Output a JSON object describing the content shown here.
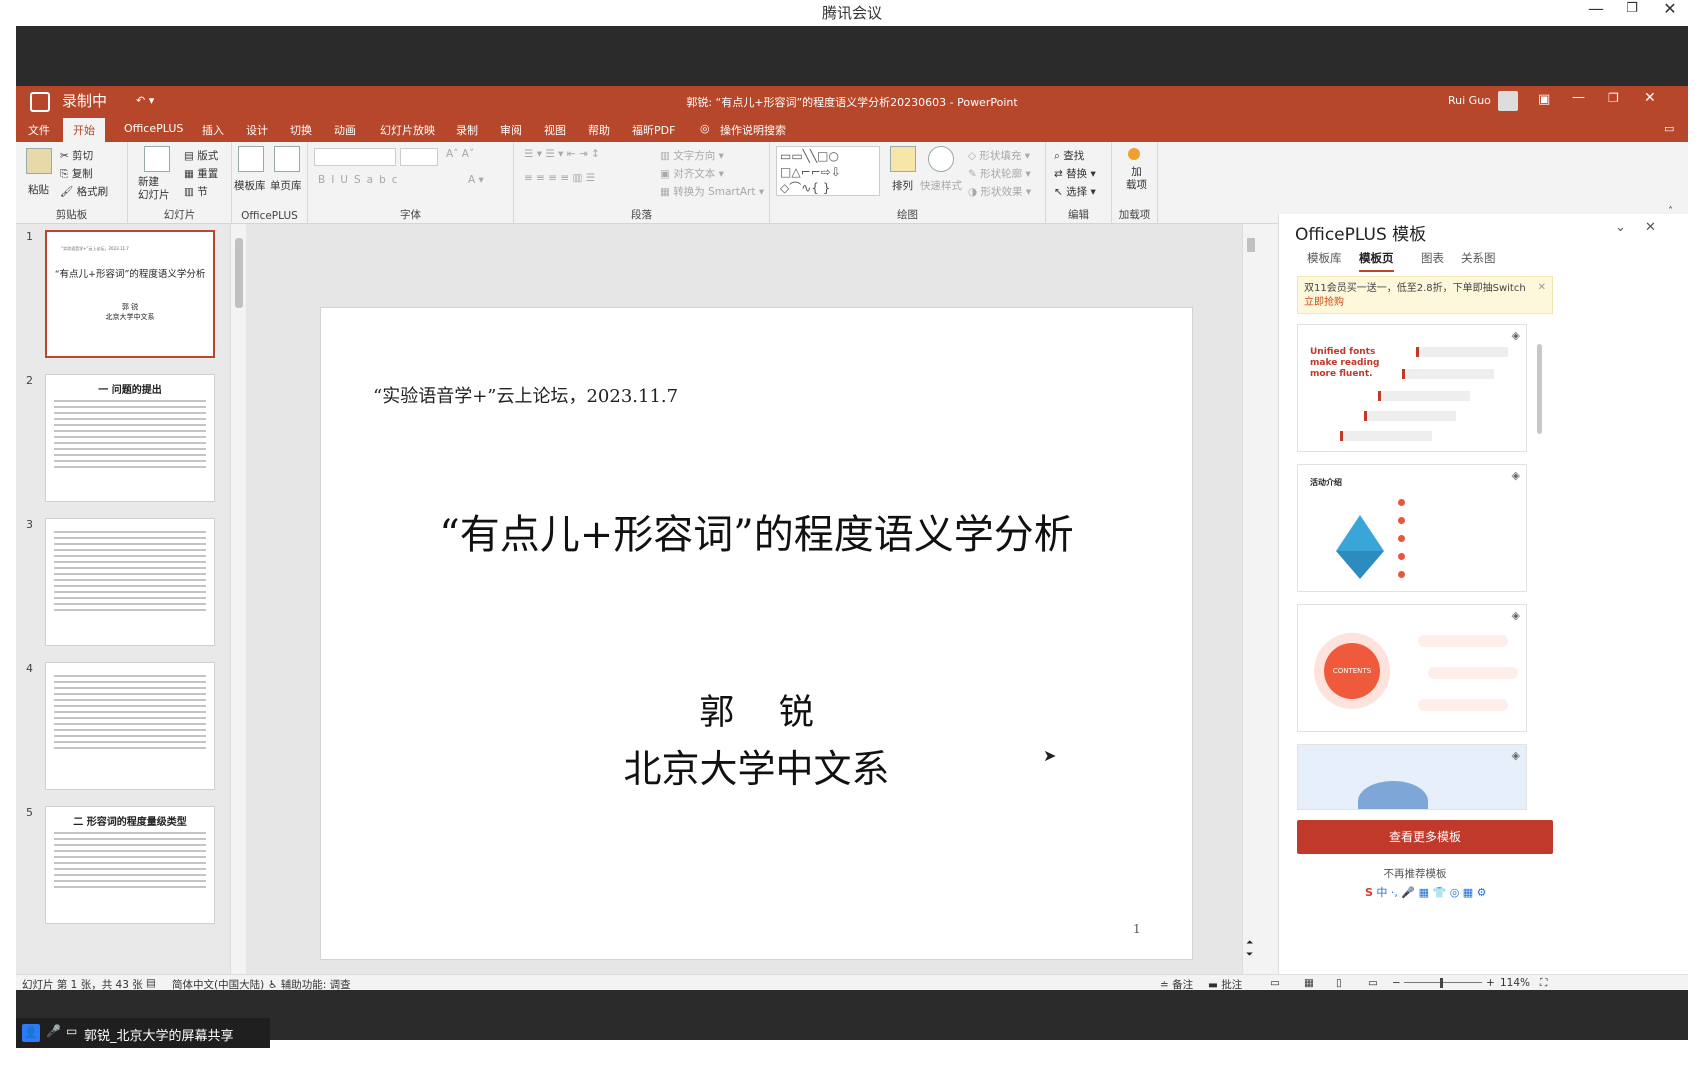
{
  "meeting_window": {
    "title": "腾讯会议",
    "share_label": "郭锐_北京大学的屏幕共享"
  },
  "recording": {
    "label": "录制中"
  },
  "ppt": {
    "doc_title": "郭锐: “有点儿+形容词”的程度语义学分析20230603  -  PowerPoint",
    "user": "Rui Guo",
    "tabs": [
      "文件",
      "开始",
      "OfficePLUS",
      "插入",
      "设计",
      "切换",
      "动画",
      "幻灯片放映",
      "录制",
      "审阅",
      "视图",
      "帮助",
      "福昕PDF",
      "操作说明搜索"
    ],
    "ribbon": {
      "clipboard": {
        "paste": "粘贴",
        "cut": "剪切",
        "copy": "复制",
        "format_painter": "格式刷",
        "label": "剪贴板"
      },
      "slides": {
        "new_slide": "新建\n幻灯片",
        "layout": "版式",
        "reset": "重置",
        "section": "节",
        "label": "幻灯片"
      },
      "officeplus": {
        "template_lib": "模板库",
        "single_page_lib": "单页库",
        "label": "OfficePLUS"
      },
      "font": {
        "label": "字体"
      },
      "paragraph": {
        "text_direction": "文字方向",
        "align_text": "对齐文本",
        "convert_smartart": "转换为 SmartArt",
        "label": "段落"
      },
      "drawing": {
        "arrange": "排列",
        "quick_styles": "快速样式",
        "shape_fill": "形状填充",
        "shape_outline": "形状轮廓",
        "shape_effects": "形状效果",
        "label": "绘图"
      },
      "editing": {
        "find": "查找",
        "replace": "替换",
        "select": "选择",
        "label": "编辑"
      },
      "addins": {
        "addin": "加\n载项",
        "label": "加载项"
      }
    },
    "thumbnails": [
      {
        "num": "1",
        "title": "“有点儿+形容词”的程度语义学分析",
        "sub1": "郭 锐",
        "sub2": "北京大学中文系"
      },
      {
        "num": "2",
        "title": "一 问题的提出"
      },
      {
        "num": "3",
        "title": ""
      },
      {
        "num": "4",
        "title": ""
      },
      {
        "num": "5",
        "title": "二 形容词的程度量级类型"
      }
    ],
    "slide": {
      "forum": "“实验语音学+”云上论坛，2023.11.7",
      "title": "“有点儿+形容词”的程度语义学分析",
      "author": "郭    锐",
      "affiliation": "北京大学中文系",
      "page": "1"
    },
    "pane": {
      "title": "OfficePLUS 模板",
      "tabs": [
        "模板库",
        "模板页",
        "图表",
        "关系图"
      ],
      "promo": "双11会员买一送一，低至2.8折，下单即抽Switch ",
      "promo_link": "立即抢购",
      "card1_text": "Unified fonts make reading more fluent.",
      "card2_title": "活动介绍",
      "card3_center": "CONTENTS",
      "more_button": "查看更多模板",
      "no_recommend": "不再推荐模板"
    },
    "status": {
      "slide_info": "幻灯片 第 1 张，共 43 张",
      "language": "简体中文(中国大陆)",
      "accessibility": "辅助功能: 调查",
      "notes": "备注",
      "comments": "批注",
      "zoom": "114%"
    }
  }
}
